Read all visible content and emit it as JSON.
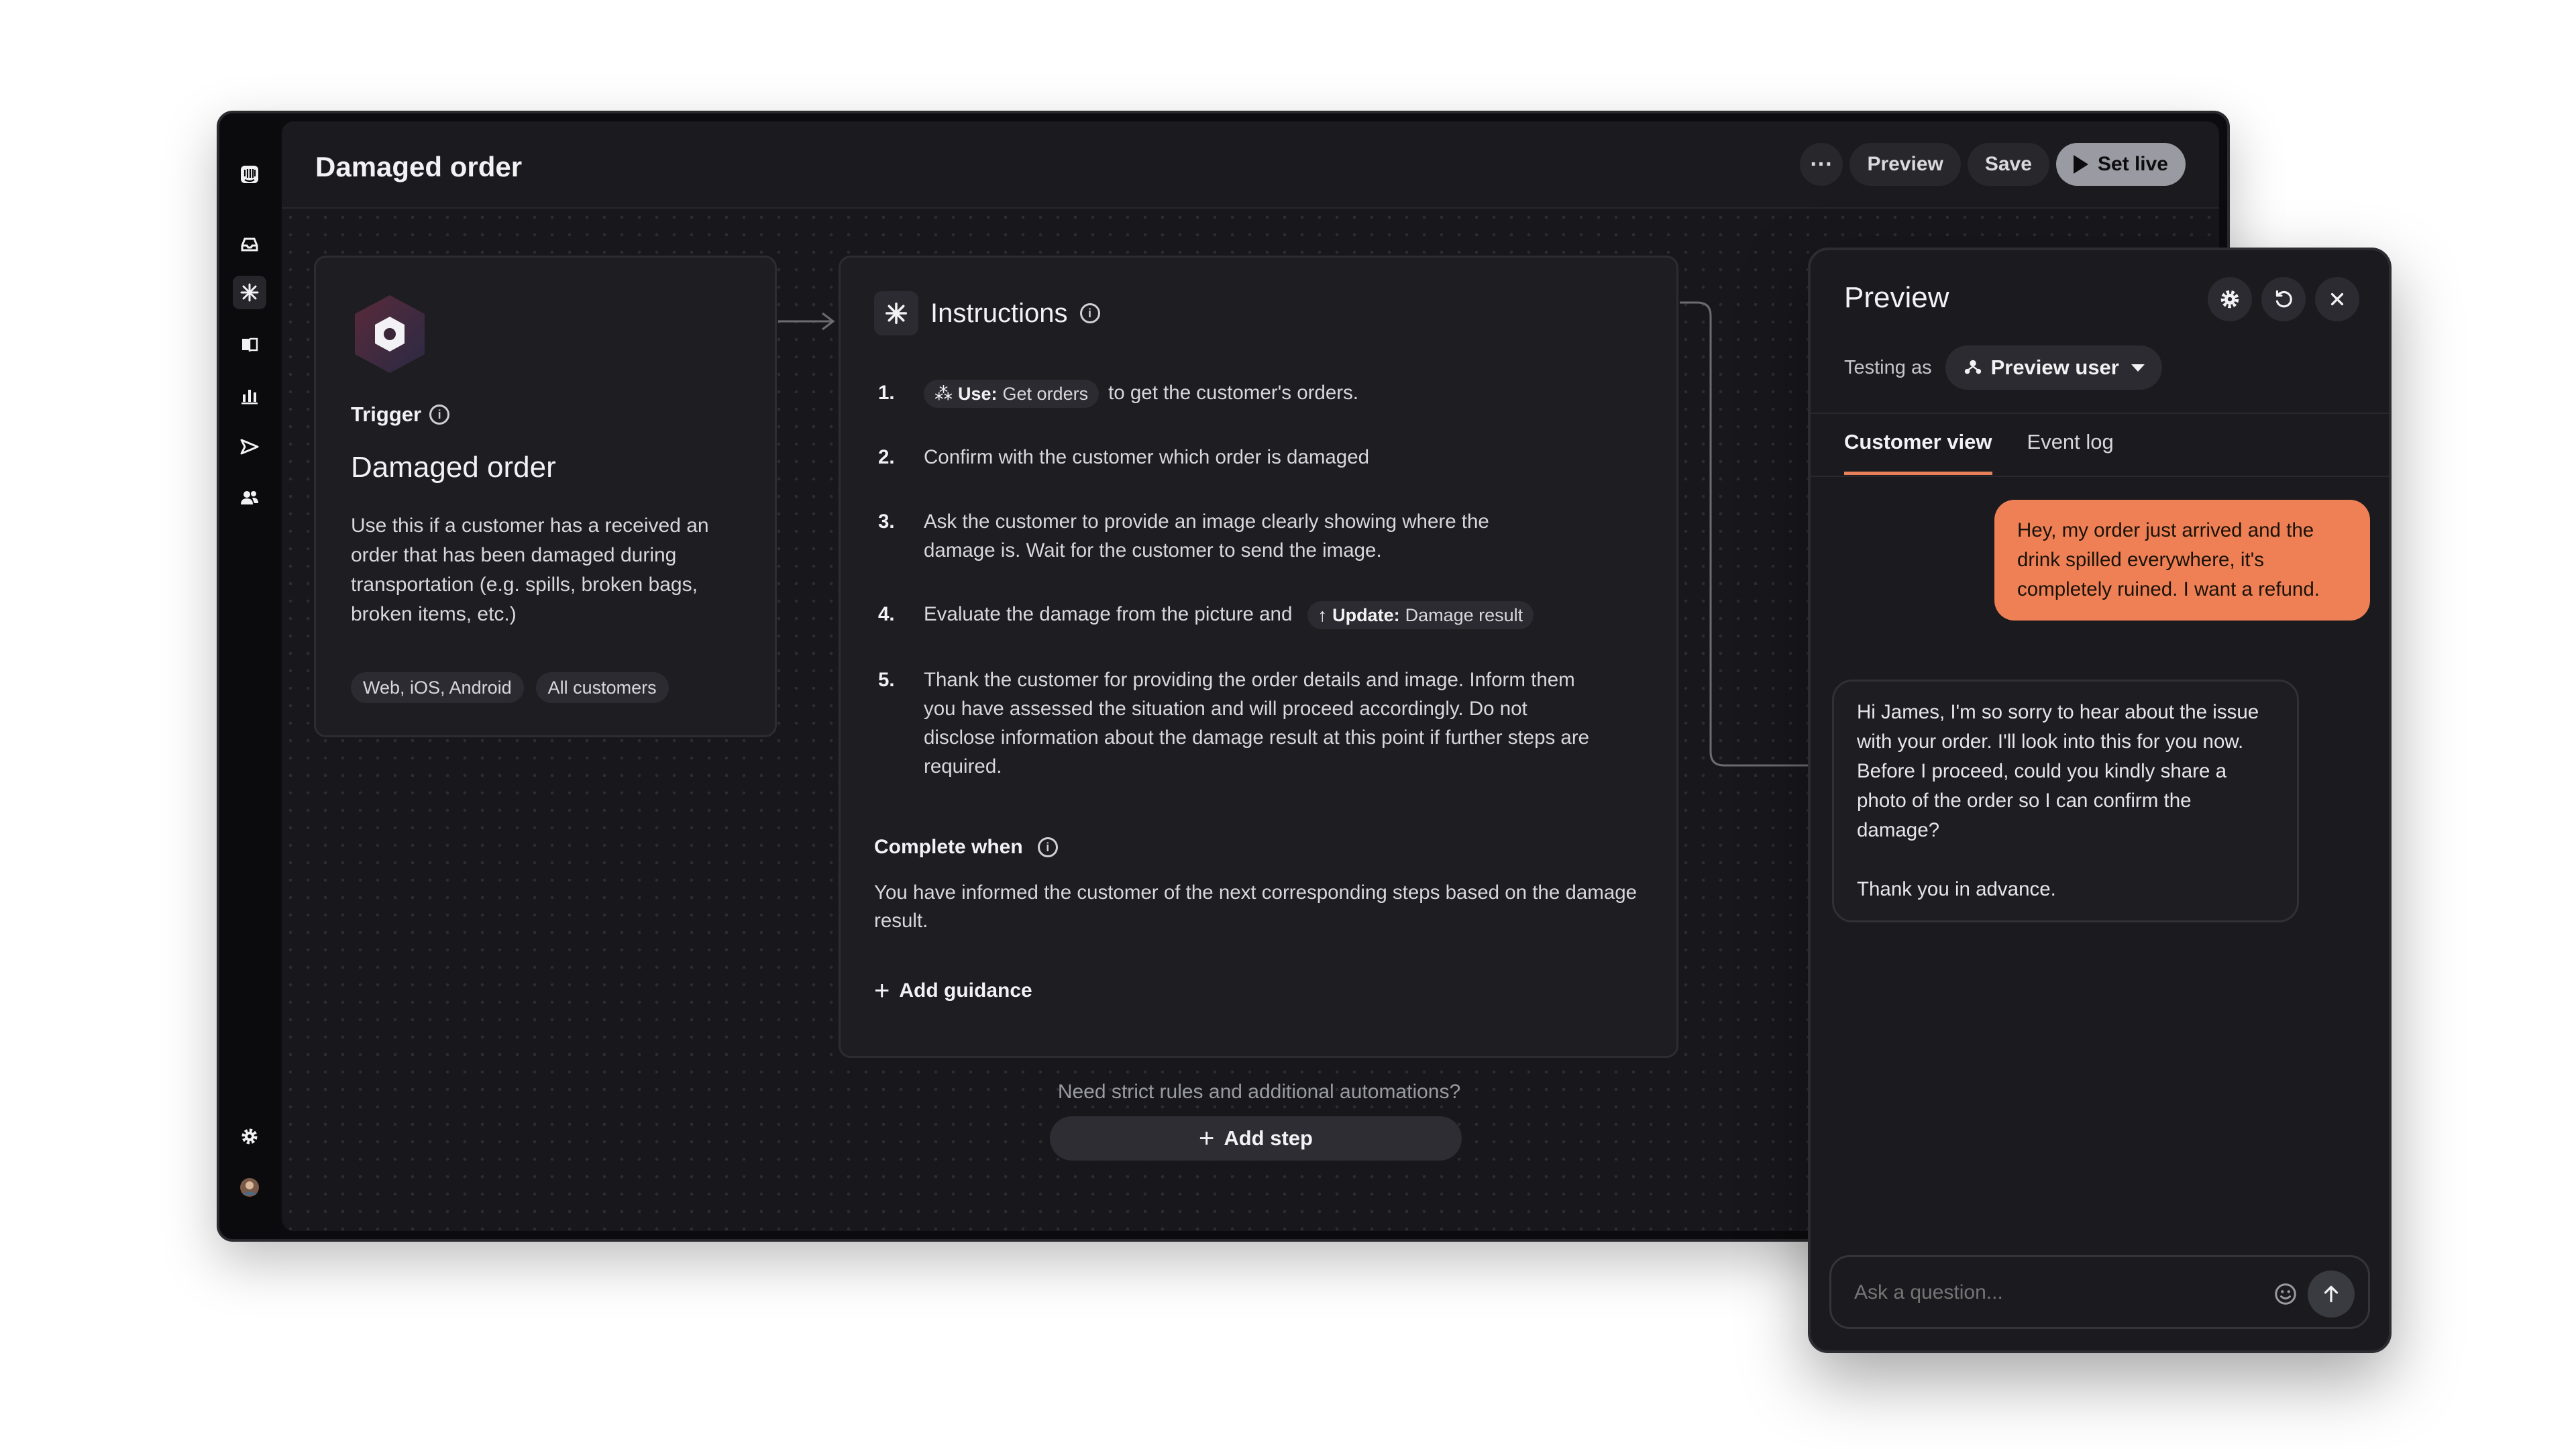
{
  "header": {
    "title": "Damaged order",
    "more_label": "···",
    "preview_label": "Preview",
    "save_label": "Save",
    "set_live_label": "Set live"
  },
  "rail": {
    "items": [
      "inbox-icon",
      "workflows-icon",
      "knowledge-icon",
      "reports-icon",
      "outbound-icon",
      "contacts-icon",
      "settings-icon",
      "avatar"
    ],
    "active": "workflows-icon"
  },
  "trigger": {
    "label": "Trigger",
    "name": "Damaged order",
    "description": "Use this if a customer has a received an order that has been damaged during transportation (e.g. spills, broken bags, broken items, etc.)",
    "tags": [
      "Web, iOS, Android",
      "All customers"
    ]
  },
  "instructions": {
    "title": "Instructions",
    "steps": [
      {
        "num": "1.",
        "pill_prefix": "Use:",
        "pill_value": "Get orders",
        "text": "to get the customer's orders."
      },
      {
        "num": "2.",
        "text": "Confirm with the customer which order is damaged"
      },
      {
        "num": "3.",
        "text": "Ask the customer to provide an image clearly showing where the damage is. Wait for the customer to send the image."
      },
      {
        "num": "4.",
        "text": "Evaluate the damage from the picture and",
        "pill_prefix": "Update:",
        "pill_value": "Damage result"
      },
      {
        "num": "5.",
        "text": "Thank the customer for providing the order details and image. Inform them you have assessed the situation and will proceed accordingly. Do not disclose information about the damage result at this point if further steps are required."
      }
    ],
    "complete_label": "Complete when",
    "complete_text": "You have informed the customer of the next corresponding steps based on the damage result.",
    "add_guidance": "Add guidance"
  },
  "footer": {
    "need_text": "Need strict rules and additional automations?",
    "add_step": "Add step"
  },
  "preview": {
    "title": "Preview",
    "testing_label": "Testing as",
    "user": "Preview user",
    "tabs": [
      "Customer view",
      "Event log"
    ],
    "active_tab": "Customer view",
    "messages": {
      "user": "Hey, my order just arrived and the drink spilled everywhere, it's completely ruined. I want a refund.",
      "bot_p1": "Hi James, I'm so sorry to hear about the issue with your order. I'll look into this for you now. Before I proceed, could you kindly share a photo of the order so I can confirm the damage?",
      "bot_p2": "Thank you in advance."
    },
    "input_placeholder": "Ask a question..."
  },
  "colors": {
    "accent": "#ef8056",
    "canvas": "#18181c",
    "card": "#1d1d22"
  }
}
